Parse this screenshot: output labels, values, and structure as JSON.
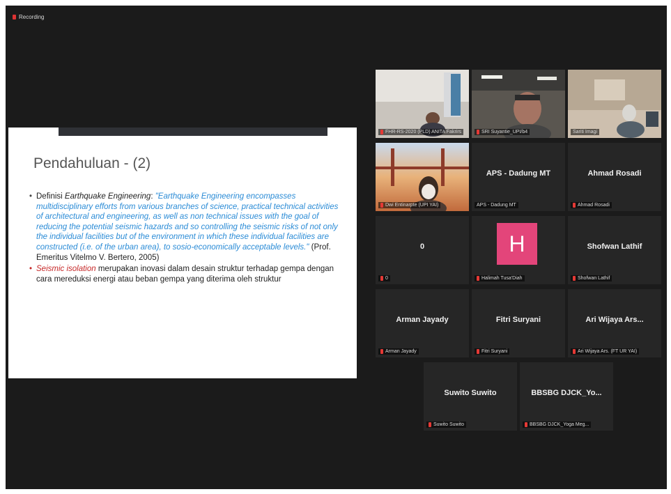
{
  "recording": {
    "label": "Recording"
  },
  "slide": {
    "title": "Pendahuluan - (2)",
    "b1_prefix": "Definisi ",
    "b1_term": "Earthquake Engineering",
    "b1_colon": ": ",
    "b1_quote": "\"Earthquake Engineering encompasses multidisciplinary efforts from various branches of science, practical technical activities of architectural and engineering, as well as non technical issues with the goal of reducing the potential seismic hazards and so controlling the seismic risks of not only the individual facilities but of the environment in which these individual facilities are constructed (i.e. of the urban area), to sosio-economically acceptable levels.\"",
    "b1_source": " (Prof. Emeritus Vitelmo V. Bertero, 2005)",
    "b2_term": "Seismic isolation",
    "b2_text": " merupakan inovasi dalam desain struktur terhadap gempa dengan cara mereduksi energi atau beban gempa yang diterima oleh struktur"
  },
  "participants": [
    {
      "name": "",
      "caption": "FHR-RS-2020 (PLD) ANITA Fakrirs"
    },
    {
      "name": "",
      "caption": "SRI Suyantie_UPI/b4"
    },
    {
      "name": "",
      "caption": "Sariti Imagi"
    },
    {
      "name": "",
      "caption": "Dwi Entinarpte (UPI YAI)"
    },
    {
      "name": "APS - Dadung MT",
      "caption": "APS - Dadung MT"
    },
    {
      "name": "Ahmad Rosadi",
      "caption": "Ahmad Rosadi"
    },
    {
      "name": "0",
      "caption": "0"
    },
    {
      "name": "H",
      "caption": "Halimah Tusa'Diah"
    },
    {
      "name": "Shofwan Lathif",
      "caption": "Shofwan Lathif"
    },
    {
      "name": "Arman Jayady",
      "caption": "Arman Jayady"
    },
    {
      "name": "Fitri Suryani",
      "caption": "Fitri Suryani"
    },
    {
      "name": "Ari Wijaya Ars...",
      "caption": "Ari Wijaya Ars. (FT UR YAI)"
    },
    {
      "name": "Suwito Suwito",
      "caption": "Suwito Suwito"
    },
    {
      "name": "BBSBG DJCK_Yo...",
      "caption": "BBSBG DJCK_Yoga Meg..."
    }
  ],
  "colors": {
    "active_speaker": "#b8d44a",
    "avatar_h": "#e3457a",
    "mic_muted": "#e53935"
  }
}
